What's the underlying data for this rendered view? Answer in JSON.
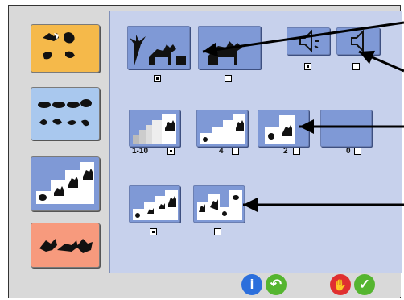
{
  "top_row": {
    "options": [
      {
        "icon": "camel-with-palms-icon",
        "checked": true
      },
      {
        "icon": "camel-icon",
        "checked": false
      },
      {
        "icon": "speaker-on-icon",
        "checked": true
      },
      {
        "icon": "speaker-off-icon",
        "checked": false
      }
    ]
  },
  "mid_row": {
    "options": [
      {
        "icon": "staircase-many-cards-icon",
        "label": "1-10",
        "checked": true
      },
      {
        "icon": "staircase-four-cards-icon",
        "label": "4",
        "checked": false
      },
      {
        "icon": "two-cards-icon",
        "label": "2",
        "checked": false
      },
      {
        "icon": "blank-card-icon",
        "label": "0",
        "checked": false
      }
    ]
  },
  "bottom_row": {
    "options": [
      {
        "icon": "ordered-cards-icon",
        "checked": true
      },
      {
        "icon": "mixed-cards-icon",
        "checked": false
      }
    ]
  },
  "sidebar": {
    "items": [
      {
        "icon": "animal-silhouettes-icon",
        "color": "#f5b94a"
      },
      {
        "icon": "animal-outlines-icon",
        "color": "#a9c8ee"
      },
      {
        "icon": "card-sequence-icon",
        "color": "#a9c8ee"
      },
      {
        "icon": "running-animals-icon",
        "color": "#f79a7d"
      }
    ]
  },
  "footer": {
    "buttons": [
      {
        "icon": "info-icon",
        "glyph": "i",
        "color": "#2c6fdc"
      },
      {
        "icon": "undo-icon",
        "glyph": "↶",
        "color": "#55b530"
      },
      {
        "icon": "stop-hand-icon",
        "glyph": "✋",
        "color": "#e03030"
      },
      {
        "icon": "ok-check-icon",
        "glyph": "✓",
        "color": "#55b530"
      }
    ]
  }
}
